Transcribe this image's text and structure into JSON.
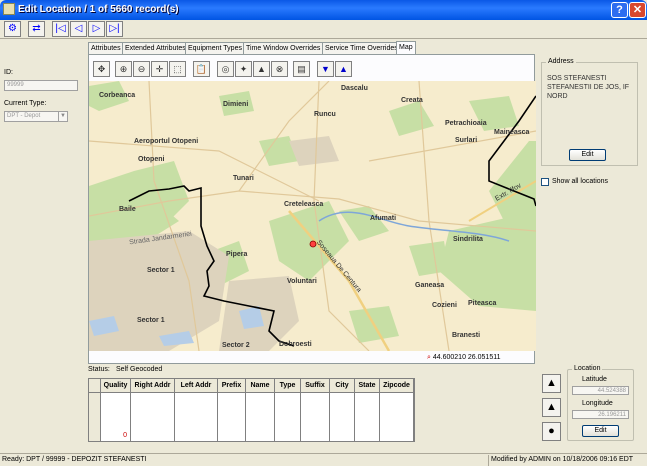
{
  "window": {
    "title": "Edit Location / 1 of 5660 record(s)",
    "help": "?",
    "close": "✕"
  },
  "toolbar": [
    {
      "name": "network-icon",
      "glyph": "⚙"
    },
    {
      "name": "transfer-icon",
      "glyph": "⇄"
    },
    {
      "name": "first-record-icon",
      "glyph": "|◁"
    },
    {
      "name": "prev-record-icon",
      "glyph": "◁"
    },
    {
      "name": "next-record-icon",
      "glyph": "▷"
    },
    {
      "name": "last-record-icon",
      "glyph": "▷|"
    }
  ],
  "left": {
    "id_label": "ID:",
    "id_value": "99999",
    "type_label": "Current Type:",
    "type_value": "DPT - Depot"
  },
  "tabs": [
    "Attributes",
    "Extended Attributes",
    "Equipment Types",
    "Time Window Overrides",
    "Service Time Overrides",
    "Map"
  ],
  "map_toolbar": [
    {
      "name": "pan-icon",
      "glyph": "✥"
    },
    {
      "name": "zoom-in-icon",
      "glyph": "⊕"
    },
    {
      "name": "zoom-out-icon",
      "glyph": "⊖"
    },
    {
      "name": "center-icon",
      "glyph": "✛"
    },
    {
      "name": "zoom-rect-icon",
      "glyph": "⬚"
    },
    {
      "name": "clipboard-icon",
      "glyph": "📋"
    },
    {
      "name": "route-icon",
      "glyph": "◎"
    },
    {
      "name": "locate-icon",
      "glyph": "✦"
    },
    {
      "name": "road-icon",
      "glyph": "▲"
    },
    {
      "name": "crosshair-icon",
      "glyph": "⊗"
    },
    {
      "name": "print-icon",
      "glyph": "▤"
    },
    {
      "name": "arrow-down-icon",
      "glyph": "▼"
    },
    {
      "name": "arrow-up-icon",
      "glyph": "▲"
    }
  ],
  "map": {
    "places": [
      {
        "t": "Corbeanca"
      },
      {
        "t": "Dimieni"
      },
      {
        "t": "Dascalu"
      },
      {
        "t": "Creata"
      },
      {
        "t": "Runcu"
      },
      {
        "t": "Petrachioaia"
      },
      {
        "t": "Maineasca"
      },
      {
        "t": "Aeroportul Otopeni"
      },
      {
        "t": "Surlari"
      },
      {
        "t": "Otopeni"
      },
      {
        "t": "Tunari"
      },
      {
        "t": "Creteleasca"
      },
      {
        "t": "Afumati"
      },
      {
        "t": "Sindrilita"
      },
      {
        "t": "Pipera"
      },
      {
        "t": "Sector 1"
      },
      {
        "t": "Voluntari"
      },
      {
        "t": "Ganeasa"
      },
      {
        "t": "Piteasca"
      },
      {
        "t": "Cozieni"
      },
      {
        "t": "Sector 2"
      },
      {
        "t": "Branesti"
      },
      {
        "t": "Sector 1"
      },
      {
        "t": "Dobroesti"
      },
      {
        "t": "Baile"
      },
      {
        "t": "Strada Jandarmeriei"
      },
      {
        "t": "Soseaua De Centura"
      },
      {
        "t": "Extr. Ilfov"
      }
    ],
    "coords": "44.600210 26.051511"
  },
  "address": {
    "title": "Address",
    "text": "SOS STEFANESTI STEFANESTII DE JOS, IF NORD",
    "edit": "Edit",
    "show_all": "Show all locations"
  },
  "status": {
    "label": "Status:",
    "value": "Self Geocoded"
  },
  "grid": {
    "columns": [
      "Quality",
      "Right Addr",
      "Left Addr",
      "Prefix",
      "Name",
      "Type",
      "Suffix",
      "City",
      "State",
      "Zipcode"
    ],
    "quality_value": "0"
  },
  "location": {
    "title": "Location",
    "lat_label": "Latitude",
    "lat_value": "44.524388",
    "lon_label": "Longitude",
    "lon_value": "26.196211",
    "edit": "Edit"
  },
  "statusbar": {
    "left": "Ready: DPT / 99999 - DEPOZIT STEFANESTI",
    "right": "Modified by ADMIN on 10/18/2006 09:16 EDT"
  }
}
